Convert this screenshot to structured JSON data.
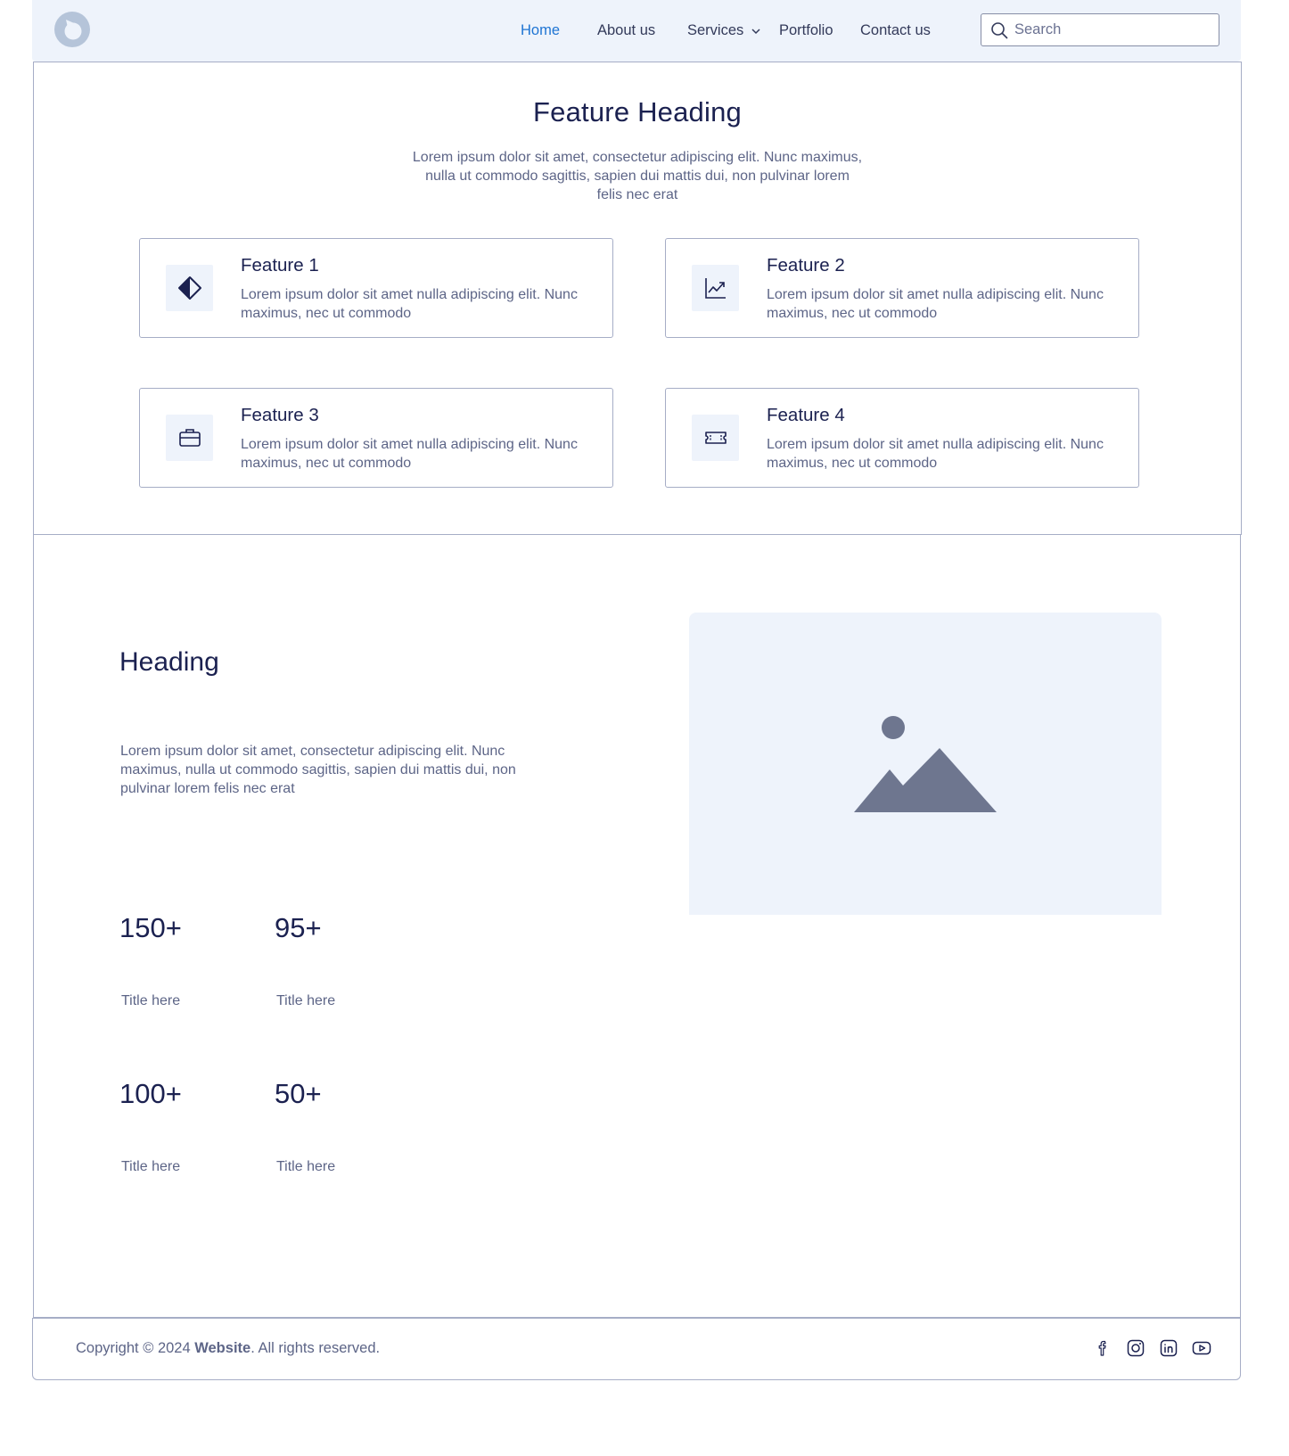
{
  "header": {
    "logo_icon": "brand-logo-icon",
    "nav": [
      {
        "label": "Home",
        "active": true
      },
      {
        "label": "About us",
        "active": false
      },
      {
        "label": "Services",
        "active": false
      },
      {
        "label": "Portfolio",
        "active": false
      },
      {
        "label": "Contact us",
        "active": false
      }
    ],
    "search_placeholder": "Search"
  },
  "features": {
    "heading": "Feature Heading",
    "subtitle": "Lorem ipsum dolor sit amet, consectetur adipiscing elit. Nunc maximus, nulla ut commodo sagittis, sapien dui mattis dui, non pulvinar lorem felis nec erat",
    "cards": [
      {
        "title": "Feature 1",
        "desc": "Lorem ipsum dolor sit amet nulla adipiscing elit. Nunc maximus, nec ut commodo",
        "icon": "contrast-icon"
      },
      {
        "title": "Feature 2",
        "desc": "Lorem ipsum dolor sit amet nulla adipiscing elit. Nunc maximus, nec ut commodo",
        "icon": "chart-line-icon"
      },
      {
        "title": "Feature 3",
        "desc": "Lorem ipsum dolor sit amet nulla adipiscing elit. Nunc maximus, nec ut commodo",
        "icon": "briefcase-icon"
      },
      {
        "title": "Feature 4",
        "desc": "Lorem ipsum dolor sit amet nulla adipiscing elit. Nunc maximus, nec ut commodo",
        "icon": "ticket-icon"
      }
    ]
  },
  "stats_section": {
    "heading": "Heading",
    "body": "Lorem ipsum dolor sit amet, consectetur adipiscing elit. Nunc maximus, nulla ut commodo sagittis, sapien dui mattis dui, non pulvinar lorem felis nec erat",
    "stats": [
      {
        "value": "150+",
        "label": "Title here"
      },
      {
        "value": "95+",
        "label": "Title here"
      },
      {
        "value": "100+",
        "label": "Title here"
      },
      {
        "value": "50+",
        "label": "Title here"
      }
    ],
    "image_icon": "image-placeholder-icon"
  },
  "footer": {
    "copyright_prefix": "Copyright © 2024 ",
    "brand": "Website",
    "copyright_suffix": ". All rights reserved.",
    "socials": [
      "facebook-icon",
      "instagram-icon",
      "linkedin-icon",
      "youtube-icon"
    ]
  },
  "colors": {
    "accent": "#1e74d3",
    "heading": "#1b2150",
    "body_text": "#5d6587",
    "soft_background": "#eef3fb",
    "border": "#a6adc6"
  }
}
